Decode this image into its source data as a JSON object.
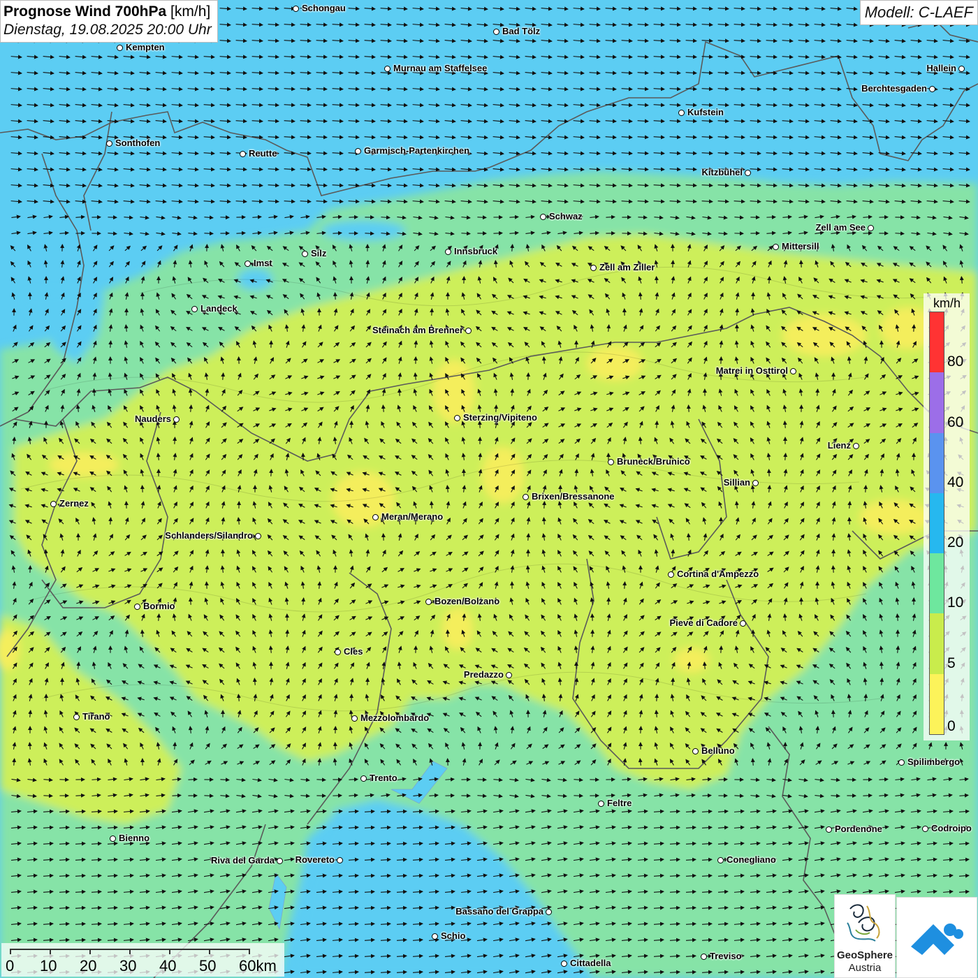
{
  "title": {
    "main": "Prognose Wind 700hPa",
    "unit": "[km/h]",
    "datetime": "Dienstag, 19.08.2025 20:00 Uhr"
  },
  "model_label": "Modell: C-LAEF",
  "legend": {
    "unit": "km/h",
    "ticks": [
      "80",
      "60",
      "40",
      "20",
      "10",
      "5",
      "0"
    ],
    "colors": [
      "#ff3333",
      "#9c6ee8",
      "#5a93ef",
      "#26b8ef",
      "#6ee79e",
      "#c9ec4c",
      "#fcf35a"
    ]
  },
  "colors": {
    "strong_wind": "#59cdf2",
    "moderate_wind": "#88e6a8",
    "light_wind": "#cdef58",
    "calm": "#f6ee5a",
    "border": "#555555"
  },
  "scale_bar": {
    "labels": [
      "0",
      "10",
      "20",
      "30",
      "40",
      "50",
      "60km"
    ]
  },
  "cities": [
    {
      "name": "Schongau"
    },
    {
      "name": "Bad Tölz"
    },
    {
      "name": "Kempten"
    },
    {
      "name": "Murnau am Staffelsee"
    },
    {
      "name": "Hallein"
    },
    {
      "name": "Berchtesgaden"
    },
    {
      "name": "Kufstein"
    },
    {
      "name": "Sonthofen"
    },
    {
      "name": "Reutte"
    },
    {
      "name": "Garmisch-Partenkirchen"
    },
    {
      "name": "Kitzbühel"
    },
    {
      "name": "Schwaz"
    },
    {
      "name": "Zell am See"
    },
    {
      "name": "Innsbruck"
    },
    {
      "name": "Mittersill"
    },
    {
      "name": "Silz"
    },
    {
      "name": "Imst"
    },
    {
      "name": "Zell am Ziller"
    },
    {
      "name": "Landeck"
    },
    {
      "name": "Steinach am Brenner"
    },
    {
      "name": "Matrei in Osttirol"
    },
    {
      "name": "Nauders"
    },
    {
      "name": "Sterzing/Vipiteno"
    },
    {
      "name": "Lienz"
    },
    {
      "name": "Bruneck/Brunico"
    },
    {
      "name": "Sillian"
    },
    {
      "name": "Brixen/Bressanone"
    },
    {
      "name": "Zernez"
    },
    {
      "name": "Meran/Merano"
    },
    {
      "name": "Schlanders/Silandro"
    },
    {
      "name": "Cortina d'Ampezzo"
    },
    {
      "name": "Bozen/Bolzano"
    },
    {
      "name": "Bormio"
    },
    {
      "name": "Pieve di Cadore"
    },
    {
      "name": "Cles"
    },
    {
      "name": "Predazzo"
    },
    {
      "name": "Tirano"
    },
    {
      "name": "Mezzolombardo"
    },
    {
      "name": "Belluno"
    },
    {
      "name": "Spilimbergo"
    },
    {
      "name": "Trento"
    },
    {
      "name": "Feltre"
    },
    {
      "name": "Pordenone"
    },
    {
      "name": "Codroipo"
    },
    {
      "name": "Bienno"
    },
    {
      "name": "Riva del Garda"
    },
    {
      "name": "Rovereto"
    },
    {
      "name": "Conegliano"
    },
    {
      "name": "Bassano del Grappa"
    },
    {
      "name": "Schio"
    },
    {
      "name": "Treviso"
    },
    {
      "name": "Cittadella"
    }
  ],
  "logo": {
    "name": "GeoSphere",
    "sub": "Austria"
  }
}
